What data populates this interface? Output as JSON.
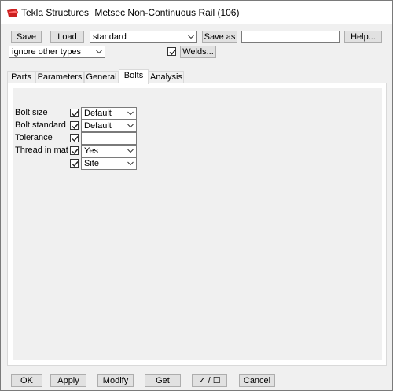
{
  "window": {
    "app_name": "Tekla Structures",
    "dialog_title": "Metsec Non-Continuous Rail (106)"
  },
  "toolbar": {
    "save_label": "Save",
    "load_label": "Load",
    "preset_value": "standard",
    "save_as_label": "Save as",
    "save_as_value": "",
    "help_label": "Help...",
    "filter_value": "ignore other types",
    "welds_checked": true,
    "welds_label": "Welds..."
  },
  "tabs": [
    {
      "label": "Parts",
      "active": false
    },
    {
      "label": "Parameters",
      "active": false
    },
    {
      "label": "General",
      "active": false
    },
    {
      "label": "Bolts",
      "active": true
    },
    {
      "label": "Analysis",
      "active": false
    }
  ],
  "bolts": {
    "rows": [
      {
        "label": "Bolt size",
        "checked": true,
        "control": "combo",
        "value": "Default"
      },
      {
        "label": "Bolt standard",
        "checked": true,
        "control": "combo",
        "value": "Default"
      },
      {
        "label": "Tolerance",
        "checked": true,
        "control": "text",
        "value": ""
      },
      {
        "label": "Thread in mat",
        "checked": true,
        "control": "combo",
        "value": "Yes"
      },
      {
        "label": "",
        "checked": true,
        "control": "combo",
        "value": "Site"
      }
    ]
  },
  "footer": {
    "ok_label": "OK",
    "apply_label": "Apply",
    "modify_label": "Modify",
    "get_label": "Get",
    "toggle_label": "✓ / ☐",
    "cancel_label": "Cancel"
  },
  "colors": {
    "app_icon": "#cc1f1f",
    "panel_bg": "#ffffff",
    "window_bg": "#f0f0f0"
  }
}
